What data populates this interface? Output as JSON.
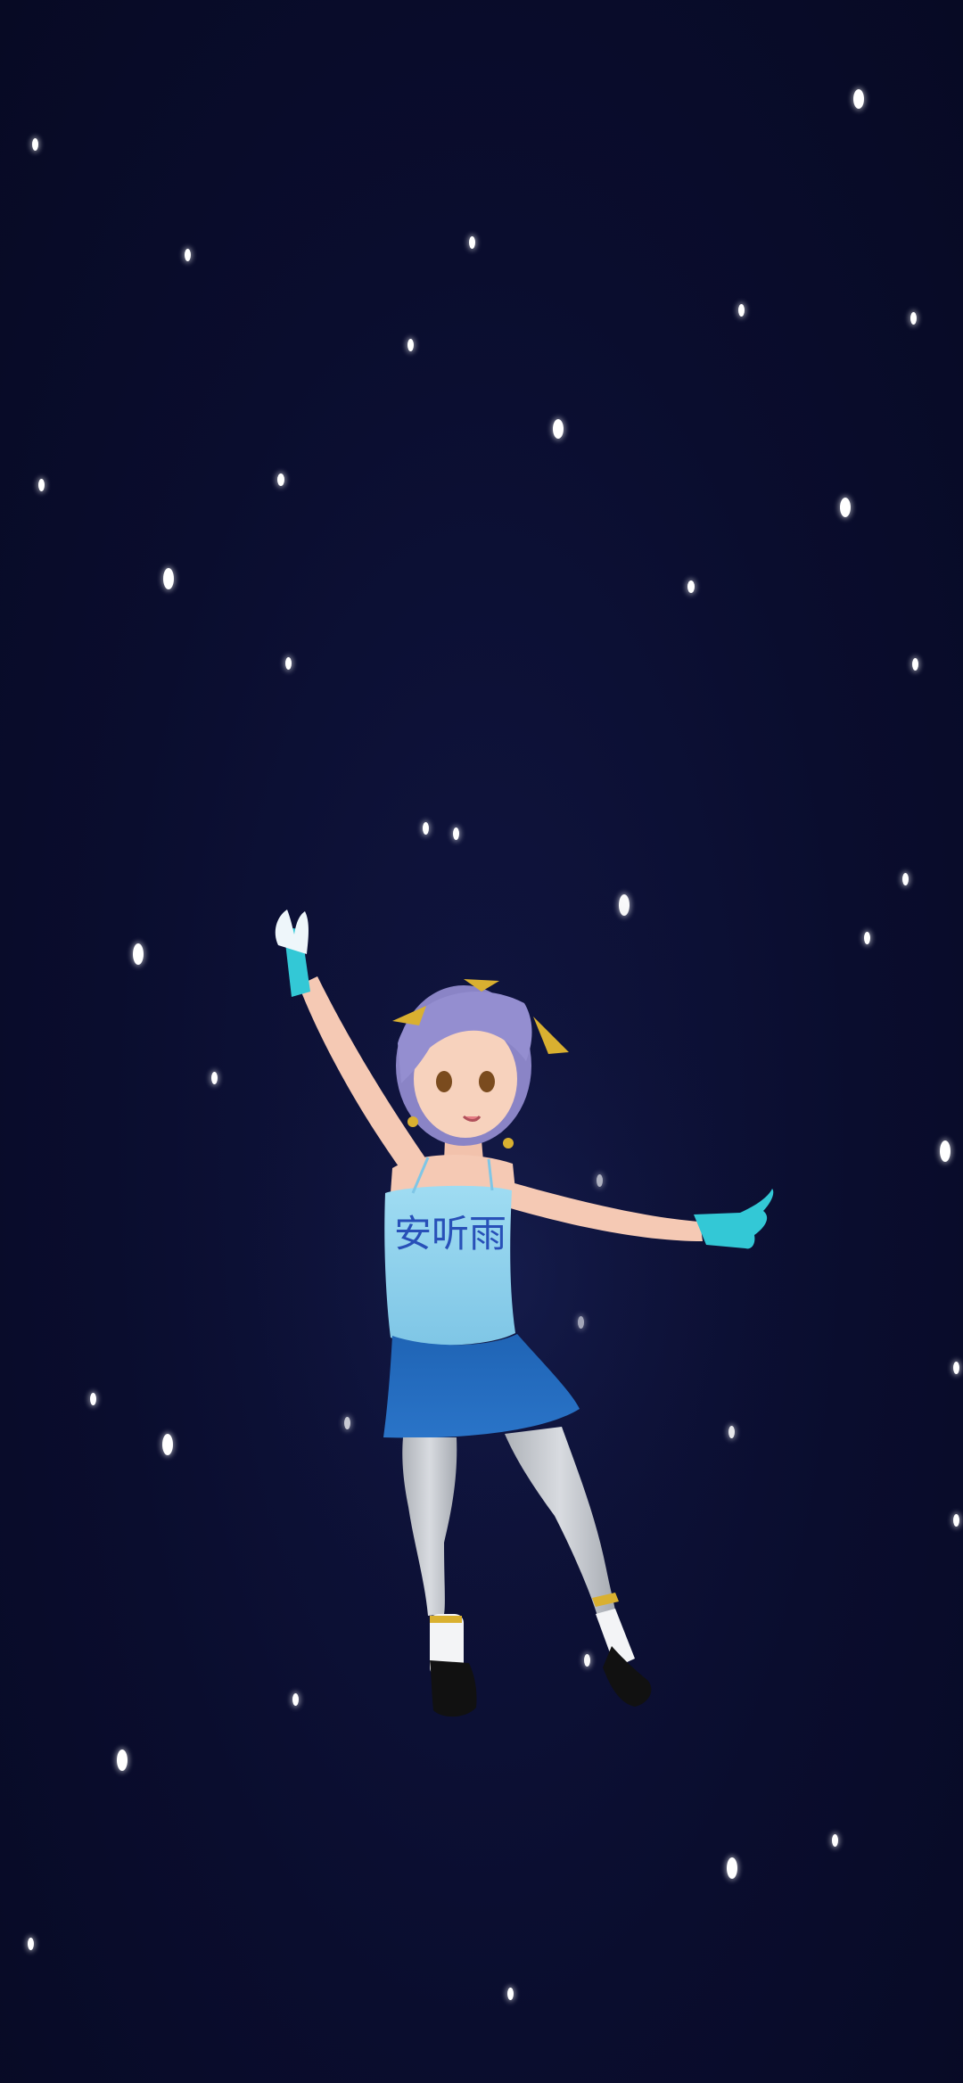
{
  "scene": {
    "background_color": "#0a0d2e",
    "snow_color": "#ffffff"
  },
  "character": {
    "shirt_text": "安听雨",
    "hair_color": "#8a84c6",
    "top_color": "#8fd3ee",
    "skirt_color": "#1f64b5",
    "glove_color": "#33c8d6",
    "stocking_color": "#c9ccd1",
    "shoe_color": "#111111",
    "accessory_color": "#d9b030"
  }
}
